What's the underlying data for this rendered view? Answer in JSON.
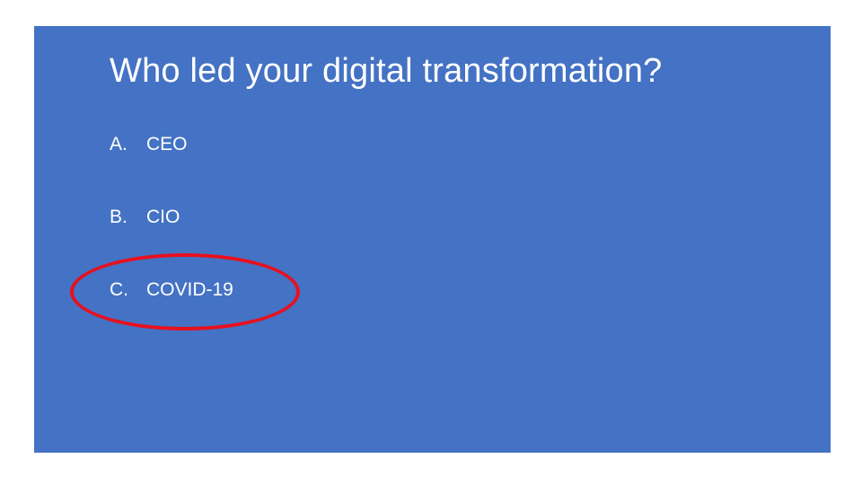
{
  "slide": {
    "background_color": "#4472c4",
    "title": "Who led your digital transformation?",
    "options": [
      {
        "letter": "A.",
        "text": "CEO"
      },
      {
        "letter": "B.",
        "text": "CIO"
      },
      {
        "letter": "C.",
        "text": "COVID-19",
        "highlighted": true
      }
    ],
    "highlight_color": "#e8101e"
  }
}
